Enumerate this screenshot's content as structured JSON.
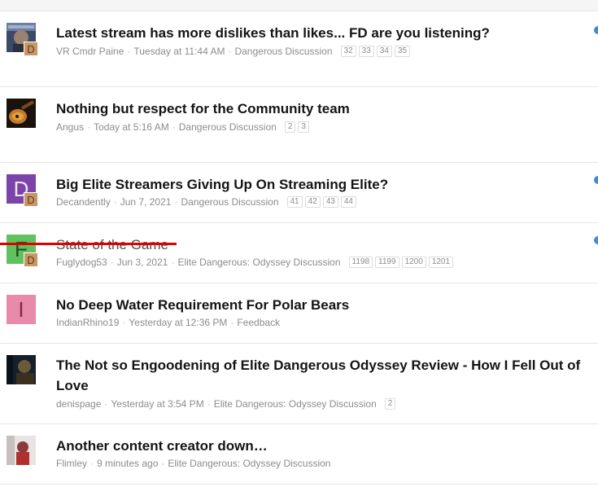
{
  "threads": [
    {
      "title": "Latest stream has more dislikes than likes... FD are you listening?",
      "author": "VR Cmdr Paine",
      "date": "Tuesday at 11:44 AM",
      "forum": "Dangerous Discussion",
      "pages": [
        "32",
        "33",
        "34",
        "35"
      ],
      "mini": "D"
    },
    {
      "title": "Nothing but respect for the Community team",
      "author": "Angus",
      "date": "Today at 5:16 AM",
      "forum": "Dangerous Discussion",
      "pages": [
        "2",
        "3"
      ]
    },
    {
      "title": "Big Elite Streamers Giving Up On Streaming Elite?",
      "author": "Decandently",
      "date": "Jun 7, 2021",
      "forum": "Dangerous Discussion",
      "pages": [
        "41",
        "42",
        "43",
        "44"
      ],
      "avatar_letter": "D",
      "mini": "D"
    },
    {
      "title": "State of the Game",
      "author": "Fuglydog53",
      "date": "Jun 3, 2021",
      "forum": "Elite Dangerous: Odyssey Discussion",
      "pages": [
        "1198",
        "1199",
        "1200",
        "1201"
      ],
      "avatar_letter": "F",
      "mini": "D"
    },
    {
      "title": "No Deep Water Requirement For Polar Bears",
      "author": "IndianRhino19",
      "date": "Yesterday at 12:36 PM",
      "forum": "Feedback",
      "pages": [],
      "avatar_letter": "I"
    },
    {
      "title": "The Not so Engoodening of Elite Dangerous Odyssey Review - How I Fell Out of Love",
      "author": "denispage",
      "date": "Yesterday at 3:54 PM",
      "forum": "Elite Dangerous: Odyssey Discussion",
      "pages": [
        "2"
      ]
    },
    {
      "title": "Another content creator down…",
      "author": "Flimley",
      "date": "9 minutes ago",
      "forum": "Elite Dangerous: Odyssey Discussion",
      "pages": []
    }
  ],
  "colors": {
    "avatar_decandently": "#7b44a8",
    "avatar_fuglydog": "#5fc25f",
    "avatar_indianrhino": "#e88aaa",
    "mini_avatar": "#c99666",
    "unread_dot": "#3a8dd6",
    "strike_line": "#e10000"
  },
  "icons": {
    "avatar_paine": "game-portrait-image",
    "avatar_angus": "guitar-image",
    "avatar_denispage": "dark-figure-image",
    "avatar_flimley": "red-figure-image"
  }
}
